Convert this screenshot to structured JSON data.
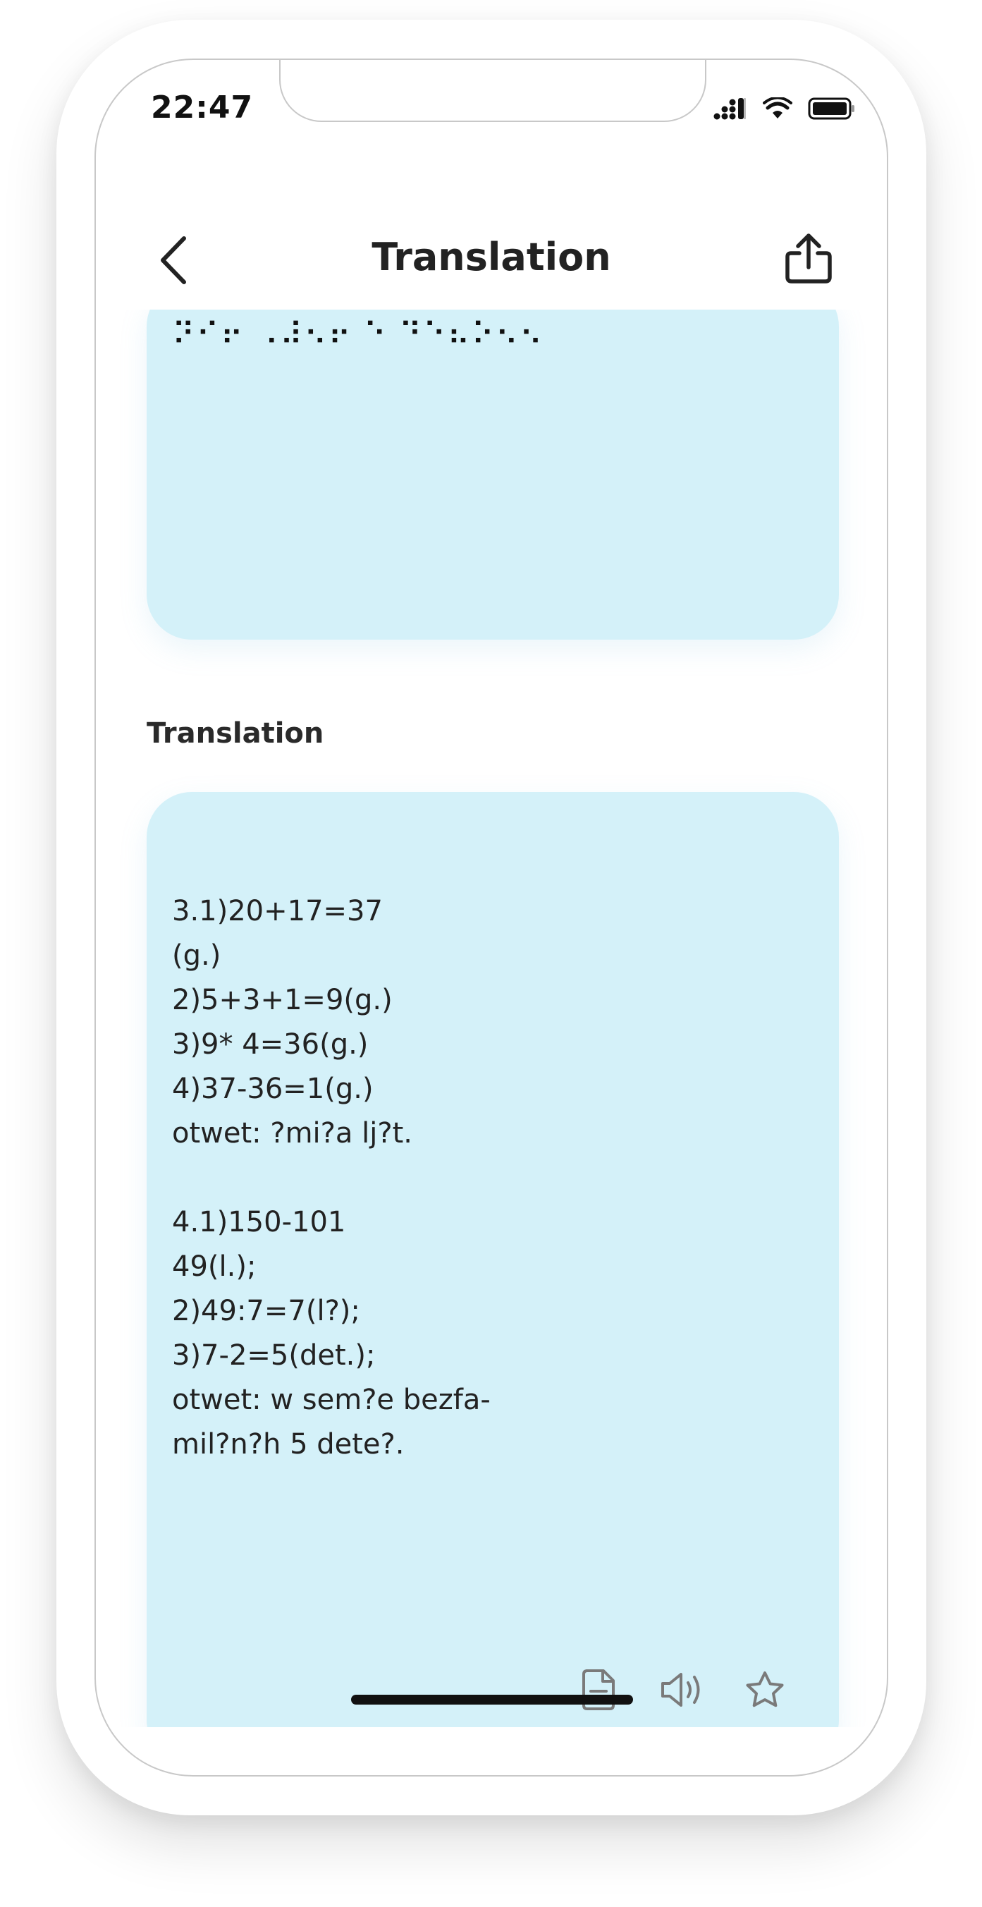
{
  "status_bar": {
    "time": "22:47",
    "icons": [
      "cellular-signal-icon",
      "wifi-icon",
      "battery-icon"
    ]
  },
  "header": {
    "title": "Translation",
    "back_icon": "chevron-left-icon",
    "share_icon": "share-icon"
  },
  "braille_card": {
    "braille_text": "⠝⠊⠖ ⠠⠼⠢⠖ ⠑ ⠙⠑⠦⠕⠢⠢"
  },
  "translation_section": {
    "label": "Translation",
    "text": "3.1)20+17=37\n(g.)\n2)5+3+1=9(g.)\n3)9* 4=36(g.)\n4)37-36=1(g.)\notwet: ?mi?a lj?t.\n\n4.1)150-101\n49(l.);\n2)49:7=7(l?);\n3)7-2=5(det.);\notwet: w sem?e bezfa-\nmil?n?h 5 dete?.",
    "actions": [
      "document-icon",
      "speaker-icon",
      "star-icon"
    ]
  },
  "colors": {
    "card_background": "#d4f1f9",
    "text": "#222222",
    "icon_gray": "#7a7a7a"
  }
}
